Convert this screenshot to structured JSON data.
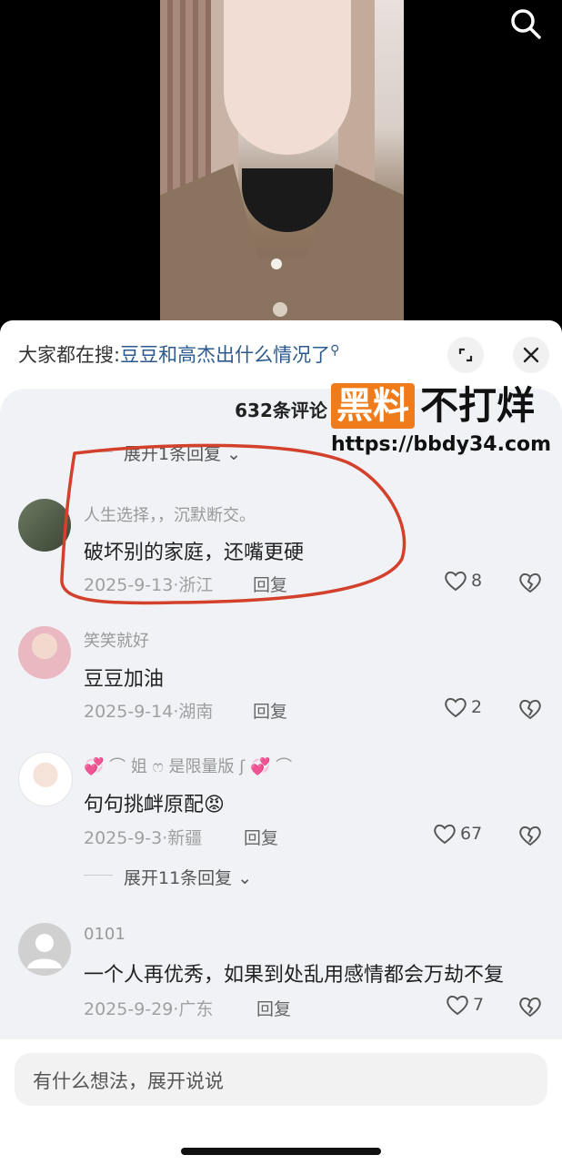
{
  "search_bar": {
    "prefix": "大家都在搜:",
    "query": "豆豆和高杰出什么情况了"
  },
  "comment_count": "632条评论",
  "watermark": {
    "box": "黑料",
    "text": "不打烊",
    "url": "https://bbdy34.com"
  },
  "expand_top": "展开1条回复",
  "comments": [
    {
      "name": "人生选择，，沉默断交。",
      "text": "破坏别的家庭，还嘴更硬",
      "date": "2025-9-13·浙江",
      "reply": "回复",
      "likes": "8"
    },
    {
      "name": "笑笑就好",
      "text": "豆豆加油",
      "date": "2025-9-14·湖南",
      "reply": "回复",
      "likes": "2"
    },
    {
      "name": "姐",
      "name2": "是限量版",
      "text": "句句挑衅原配",
      "date": "2025-9-3·新疆",
      "reply": "回复",
      "likes": "67"
    },
    {
      "name": "0101",
      "text": "一个人再优秀，如果到处乱用感情都会万劫不复",
      "date": "2025-9-29·广东",
      "reply": "回复",
      "likes": "7"
    }
  ],
  "expand_mid": "展开11条回复",
  "input_placeholder": "有什么想法，展开说说",
  "colors": {
    "link": "#2c5a8e",
    "annotation": "#d3402c",
    "watermark_box": "#f07b1a"
  }
}
